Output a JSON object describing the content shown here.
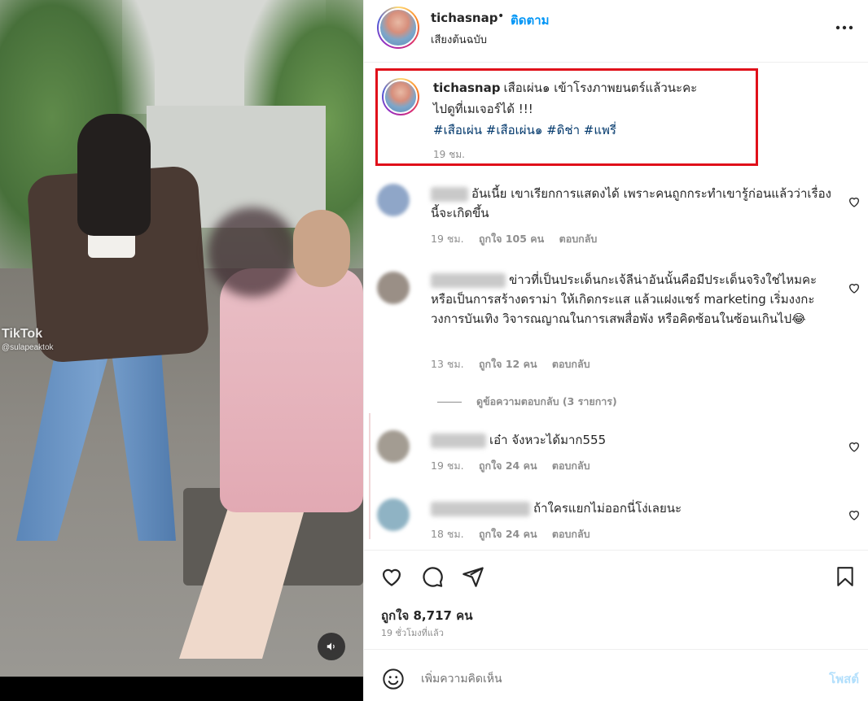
{
  "media": {
    "watermark_brand": "TikTok",
    "watermark_handle": "@sulapeaktok"
  },
  "header": {
    "username": "tichasnap",
    "separator": "•",
    "follow_label": "ติดตาม",
    "audio_label": "เสียงต้นฉบับ"
  },
  "caption": {
    "username": "tichasnap",
    "text_line1": "เสือเผ่น๑ เข้าโรงภาพยนตร์แล้วนะคะ",
    "text_line2": "ไปดูที่เมเจอร์ได้ !!!",
    "hashtags": "#เสือเผ่น #เสือเผ่น๑ #ดิช่า #แพรี่",
    "time": "19 ชม."
  },
  "comments": [
    {
      "text": "อันเนี้ย เขาเรียกการแสดงได้ เพราะคนถูกกระทำเขารู้ก่อนแล้วว่าเรื่องนี้จะเกิดขึ้น",
      "time": "19 ชม.",
      "likes": "ถูกใจ 105 คน",
      "reply": "ตอบกลับ"
    },
    {
      "text": "ข่าวที่เป็นประเด็นกะเจ้ลีน่าอันนั้นคือมีประเด็นจริงใช่ไหมคะ หรือเป็นการสร้างดราม่า ให้เกิดกระแส แล้วแฝงแชร์ marketing เริ่มงงกะวงการบันเทิง วิจารณญาณในการเสพสื่อพัง หรือคิดซ้อนในซ้อนเกินไป😂",
      "time": "13 ชม.",
      "likes": "ถูกใจ 12 คน",
      "reply": "ตอบกลับ"
    },
    {
      "text": "เอ๋า จังหวะได้มาก555",
      "time": "19 ชม.",
      "likes": "ถูกใจ 24 คน",
      "reply": "ตอบกลับ"
    },
    {
      "text": "ถ้าใครแยกไม่ออกนี่โง่เลยนะ",
      "time": "18 ชม.",
      "likes": "ถูกใจ 24 คน",
      "reply": "ตอบกลับ"
    }
  ],
  "view_replies_label": "ดูข้อความตอบกลับ (3 รายการ)",
  "actions": {
    "likes_count": "ถูกใจ 8,717 คน",
    "posted_ago": "19 ชั่วโมงที่แล้ว"
  },
  "composer": {
    "placeholder": "เพิ่มความคิดเห็น",
    "post_label": "โพสต์"
  },
  "colors": {
    "accent": "#0095f6",
    "highlight_box": "#e0101a",
    "hashtag": "#00376b",
    "muted": "#8e8e8e"
  },
  "icons": [
    "speaker-icon",
    "more-icon",
    "heart-icon",
    "comment-icon",
    "share-icon",
    "bookmark-icon",
    "emoji-icon"
  ]
}
